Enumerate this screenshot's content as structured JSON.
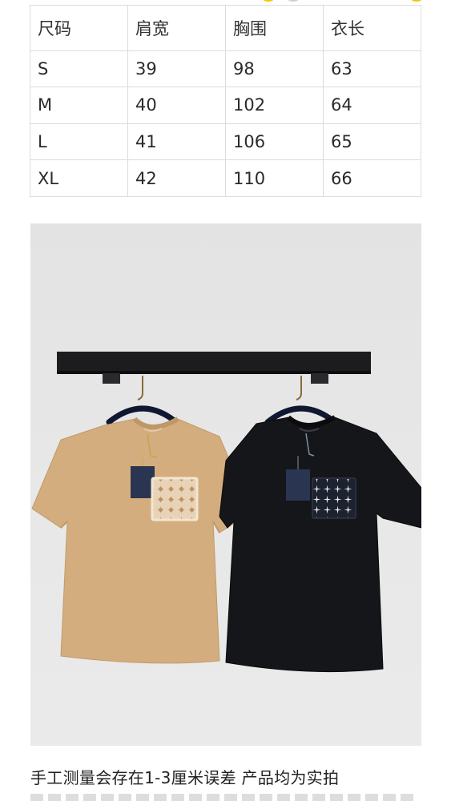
{
  "size_table": {
    "headers": [
      "尺码",
      "肩宽",
      "胸围",
      "衣长"
    ],
    "rows": [
      [
        "S",
        "39",
        "98",
        "63"
      ],
      [
        "M",
        "40",
        "102",
        "64"
      ],
      [
        "L",
        "41",
        "106",
        "65"
      ],
      [
        "XL",
        "42",
        "110",
        "66"
      ]
    ]
  },
  "photo": {
    "items": [
      {
        "color_name": "camel",
        "body_color": "#d4ad7e",
        "pocket_color": "#e9d3b8"
      },
      {
        "color_name": "black",
        "body_color": "#15161a",
        "pocket_color": "#1d2230"
      }
    ],
    "tag_color": "#2a3552",
    "rail_color": "#1c1c1e"
  },
  "caption": {
    "text": "手工测量会存在1-3厘米误差 产品均为实拍"
  },
  "top_dots_colors": [
    "#f5c400",
    "#cfcfcf",
    "#f5c400"
  ]
}
